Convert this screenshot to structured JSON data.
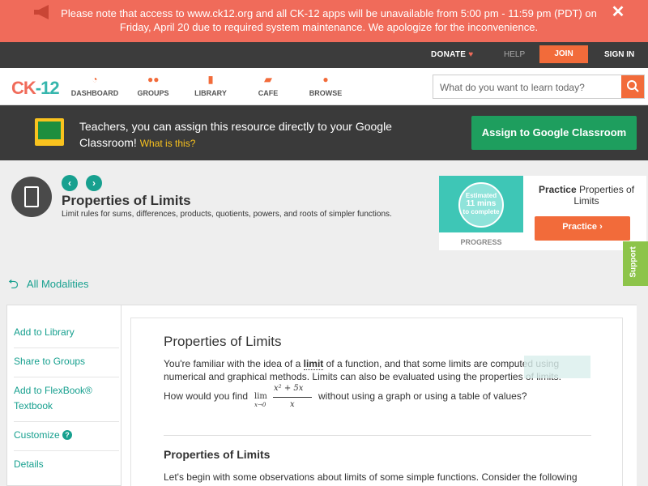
{
  "notice": {
    "message": "Please note that access to www.ck12.org and all CK-12 apps will be unavailable from 5:00 pm - 11:59 pm (PDT) on Friday, April 20 due to required system maintenance. We apologize for the inconvenience.",
    "close": "✕",
    "color": "#f06b5a"
  },
  "topbar": {
    "donate": "DONATE",
    "help": "HELP",
    "join": "JOIN",
    "signin": "SIGN IN"
  },
  "nav": {
    "logo_left": "CK",
    "logo_right": "-12",
    "items": [
      {
        "label": "DASHBOARD",
        "icon": "dashboard-icon"
      },
      {
        "label": "GROUPS",
        "icon": "groups-icon"
      },
      {
        "label": "LIBRARY",
        "icon": "library-icon"
      },
      {
        "label": "CAFE",
        "icon": "cafe-icon"
      },
      {
        "label": "BROWSE",
        "icon": "browse-icon"
      }
    ],
    "search_placeholder": "What do you want to learn today?"
  },
  "classroom": {
    "text": "Teachers, you can assign this resource directly to your Google Classroom!",
    "what": "What is this?",
    "button": "Assign to Google Classroom"
  },
  "header": {
    "title": "Properties of Limits",
    "subtitle": "Limit rules for sums, differences, products, quotients, powers, and roots of simpler functions."
  },
  "progress": {
    "line1": "Estimated",
    "line2": "11 mins",
    "line3": "to complete",
    "label": "PROGRESS"
  },
  "practice": {
    "bold": "Practice",
    "rest": "Properties of Limits",
    "button": "Practice"
  },
  "support": "Support",
  "all_modalities": "All Modalities",
  "sidebar": {
    "items": [
      "Add to Library",
      "Share to Groups",
      "Add to FlexBook® Textbook",
      "Customize",
      "Details"
    ]
  },
  "content": {
    "title": "Properties of Limits",
    "para_a": "You're familiar with the idea of a ",
    "para_limit": "limit",
    "para_b": " of a function, and that some limits are computed using numerical and graphical methods. Limits can also be evaluated using the properties of limits.",
    "question_a": "How would you find",
    "question_b": "without using a graph or using a table of values?",
    "lim": "lim",
    "lim_sub": "x→0",
    "numerator": "x² + 5x",
    "denominator": "x",
    "section_title": "Properties of Limits",
    "section_text": "Let's begin with some observations about limits of some simple functions. Consider the following"
  }
}
